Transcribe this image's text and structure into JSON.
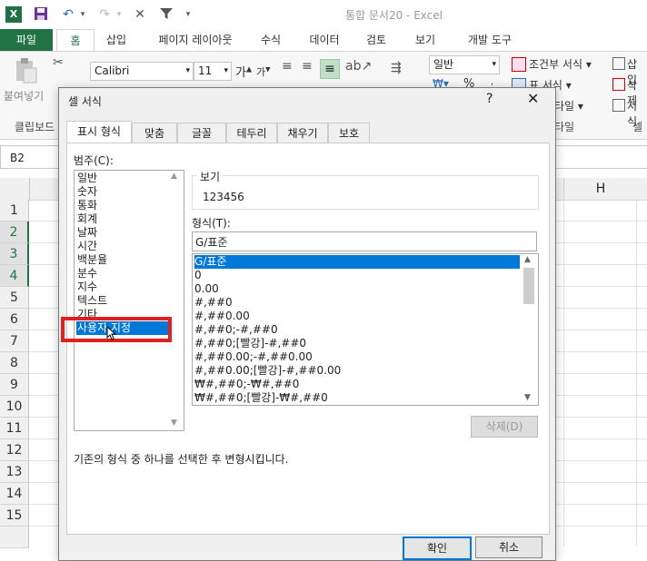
{
  "titlebar": {
    "app_badge": "X",
    "window_title": "통합 문서20 - Excel",
    "quick_access": [
      "save-icon",
      "undo-icon",
      "redo-icon",
      "close-x-icon",
      "filter-icon"
    ]
  },
  "ribbon_tabs": [
    "파일",
    "홈",
    "삽입",
    "페이지 레이아웃",
    "수식",
    "데이터",
    "검토",
    "보기",
    "개발 도구"
  ],
  "ribbon": {
    "paste_label": "붙여넣기",
    "clipboard_group": "클립보드",
    "font_name": "Calibri",
    "font_size": "11",
    "number_format": "일반",
    "cond_format": "조건부 서식",
    "table_format": "표 서식",
    "style_label": "타일",
    "style_group": "타일",
    "insert_label": "삽입",
    "delete_label": "삭제",
    "format_label": "서식",
    "cells_group": "셀",
    "percent": "%"
  },
  "formula_bar": {
    "name_box": "B2"
  },
  "grid": {
    "visible_col": "H",
    "rows": [
      "1",
      "2",
      "3",
      "4",
      "5",
      "6",
      "7",
      "8",
      "9",
      "10",
      "11",
      "12",
      "13",
      "14",
      "15"
    ],
    "selected_rows": [
      "2",
      "3",
      "4"
    ]
  },
  "dialog": {
    "title": "셀 서식",
    "help": "?",
    "close": "✕",
    "tabs": [
      "표시 형식",
      "맞춤",
      "글꼴",
      "테두리",
      "채우기",
      "보호"
    ],
    "category_label": "범주(C):",
    "categories": [
      "일반",
      "숫자",
      "통화",
      "회계",
      "날짜",
      "시간",
      "백분율",
      "분수",
      "지수",
      "텍스트",
      "기타",
      "사용자 지정"
    ],
    "selected_category": "사용자 지정",
    "sample_label": "보기",
    "sample_value": "123456",
    "format_label": "형식(T):",
    "format_value": "G/표준",
    "formats": [
      "G/표준",
      "0",
      "0.00",
      "#,##0",
      "#,##0.00",
      "#,##0;-#,##0",
      "#,##0;[빨강]-#,##0",
      "#,##0.00;-#,##0.00",
      "#,##0.00;[빨강]-#,##0.00",
      "₩#,##0;-₩#,##0",
      "₩#,##0;[빨강]-₩#,##0"
    ],
    "delete_button": "삭제(D)",
    "description": "기존의 형식 중 하나를 선택한 후 변형시킵니다.",
    "ok_button": "확인",
    "cancel_button": "취소"
  },
  "colors": {
    "excel_green": "#217346",
    "selection_blue": "#0078d7",
    "highlight_red": "#e02020"
  }
}
